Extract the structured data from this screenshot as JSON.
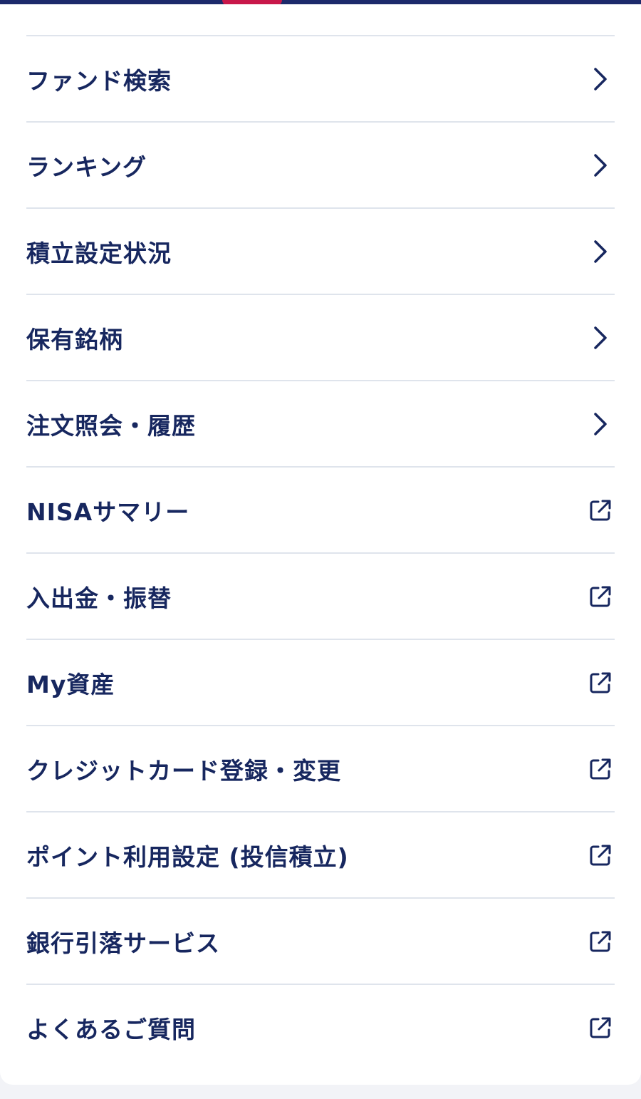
{
  "menu": {
    "items": [
      {
        "label": "ファンド検索",
        "icon": "chevron-right-icon"
      },
      {
        "label": "ランキング",
        "icon": "chevron-right-icon"
      },
      {
        "label": "積立設定状況",
        "icon": "chevron-right-icon"
      },
      {
        "label": "保有銘柄",
        "icon": "chevron-right-icon"
      },
      {
        "label": "注文照会・履歴",
        "icon": "chevron-right-icon"
      },
      {
        "label": "NISAサマリー",
        "icon": "external-link-icon"
      },
      {
        "label": "入出金・振替",
        "icon": "external-link-icon"
      },
      {
        "label": "My資産",
        "icon": "external-link-icon"
      },
      {
        "label": "クレジットカード登録・変更",
        "icon": "external-link-icon"
      },
      {
        "label": "ポイント利用設定 (投信積立)",
        "icon": "external-link-icon"
      },
      {
        "label": "銀行引落サービス",
        "icon": "external-link-icon"
      },
      {
        "label": "よくあるご質問",
        "icon": "external-link-icon"
      }
    ]
  },
  "colors": {
    "text": "#17275f",
    "divider": "#dfe4ec",
    "top_bar": "#1d2a6b",
    "tab_indicator": "#c8174a",
    "page_background": "#f2f3f7",
    "card_background": "#ffffff"
  }
}
